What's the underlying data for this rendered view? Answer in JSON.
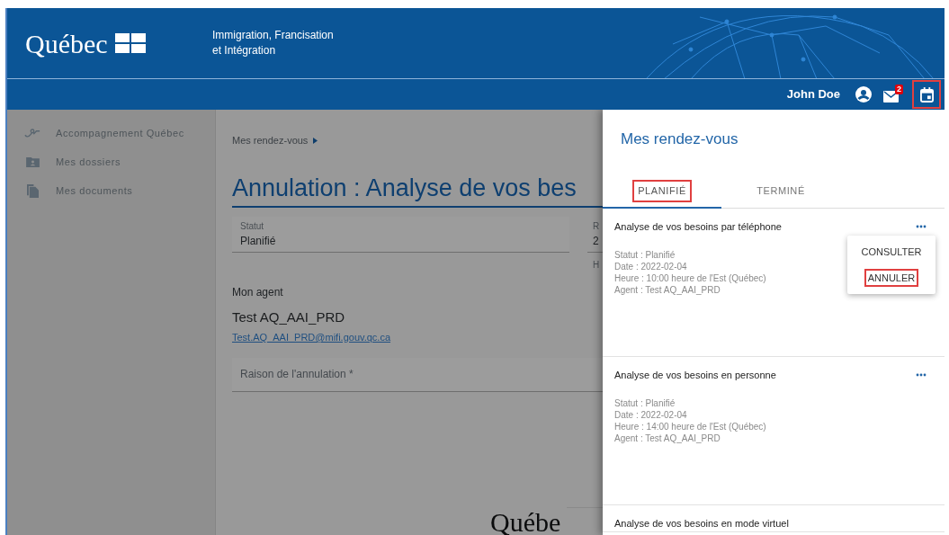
{
  "header": {
    "logo": "Québec",
    "ministry_line_1": "Immigration, Francisation",
    "ministry_line_2": "et Intégration"
  },
  "top_bar": {
    "user_name": "John Doe",
    "mail_badge": "2",
    "calendar_highlighted": true
  },
  "sidebar": {
    "items": [
      {
        "kind": "handshake",
        "label": "Accompagnement Québec"
      },
      {
        "kind": "folder",
        "label": "Mes dossiers"
      },
      {
        "kind": "documents",
        "label": "Mes documents"
      }
    ]
  },
  "main": {
    "breadcrumb": "Mes rendez-vous",
    "title": "Annulation : Analyse de vos bes",
    "status_field": {
      "label": "Statut",
      "value": "Planifié"
    },
    "column_2": {
      "label": "R",
      "value": "2",
      "note": "H"
    },
    "agent_heading": "Mon agent",
    "agent_name": "Test AQ_AAI_PRD",
    "agent_email": "Test.AQ_AAI_PRD@mifi.gouv.qc.ca",
    "reason_field": {
      "placeholder": "Raison de l'annulation *"
    },
    "footer_logo": "Québe"
  },
  "panel": {
    "title": "Mes rendez-vous",
    "tabs": [
      {
        "label": "PLANIFIÉ",
        "selected": true,
        "highlighted": true
      },
      {
        "label": "TERMINÉ",
        "selected": false,
        "highlighted": false
      }
    ],
    "appointments": [
      {
        "title": "Analyse de vos besoins par téléphone",
        "lines": [
          "Statut : Planifié",
          "Date : 2022-02-04",
          "Heure : 10:00 heure de l'Est (Québec)",
          "Agent : Test AQ_AAI_PRD"
        ],
        "menu_open": true
      },
      {
        "title": "Analyse de vos besoins en personne",
        "lines": [
          "Statut : Planifié",
          "Date : 2022-02-04",
          "Heure : 14:00 heure de l'Est (Québec)",
          "Agent : Test AQ_AAI_PRD"
        ],
        "menu_open": false
      },
      {
        "title": "Analyse de vos besoins en mode virtuel",
        "menu_open": false
      }
    ],
    "menu": [
      {
        "label": "CONSULTER",
        "highlighted": false
      },
      {
        "label": "ANNULER",
        "highlighted": true
      }
    ]
  }
}
